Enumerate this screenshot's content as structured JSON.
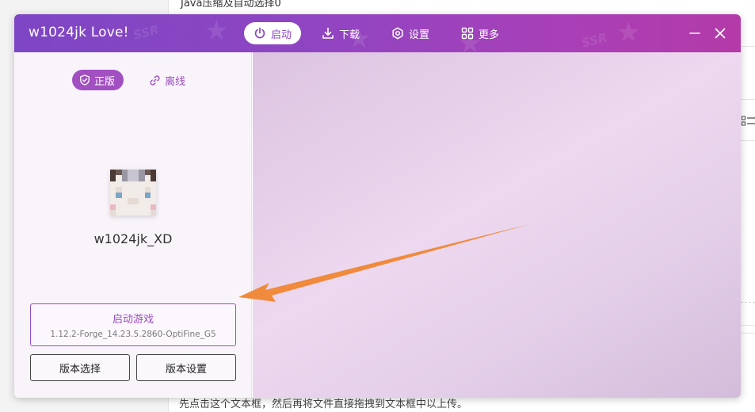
{
  "background": {
    "top_text": "Java压缩及自动选择0",
    "bottom_text": "先点击这个文本框，然后再将文件直接拖拽到文本框中以上传。"
  },
  "window": {
    "title": "w1024jk Love!",
    "nav": [
      {
        "label": "启动",
        "icon": "power-icon",
        "active": true
      },
      {
        "label": "下载",
        "icon": "download-icon",
        "active": false
      },
      {
        "label": "设置",
        "icon": "settings-icon",
        "active": false
      },
      {
        "label": "更多",
        "icon": "grid-icon",
        "active": false
      }
    ],
    "controls": {
      "minimize": "minimize-icon",
      "close": "close-icon"
    },
    "deco_text": "SSR"
  },
  "login": {
    "mode_genuine": "正版",
    "mode_offline": "离线",
    "username": "w1024jk_XD"
  },
  "launch": {
    "title": "启动游戏",
    "version": "1.12.2-Forge_14.23.5.2860-OptiFine_G5",
    "version_select": "版本选择",
    "version_settings": "版本设置"
  },
  "colors": {
    "accent": "#9b4cbf",
    "titlebar_start": "#7d46c4",
    "titlebar_end": "#b43aa8",
    "arrow": "#f08a3c"
  }
}
